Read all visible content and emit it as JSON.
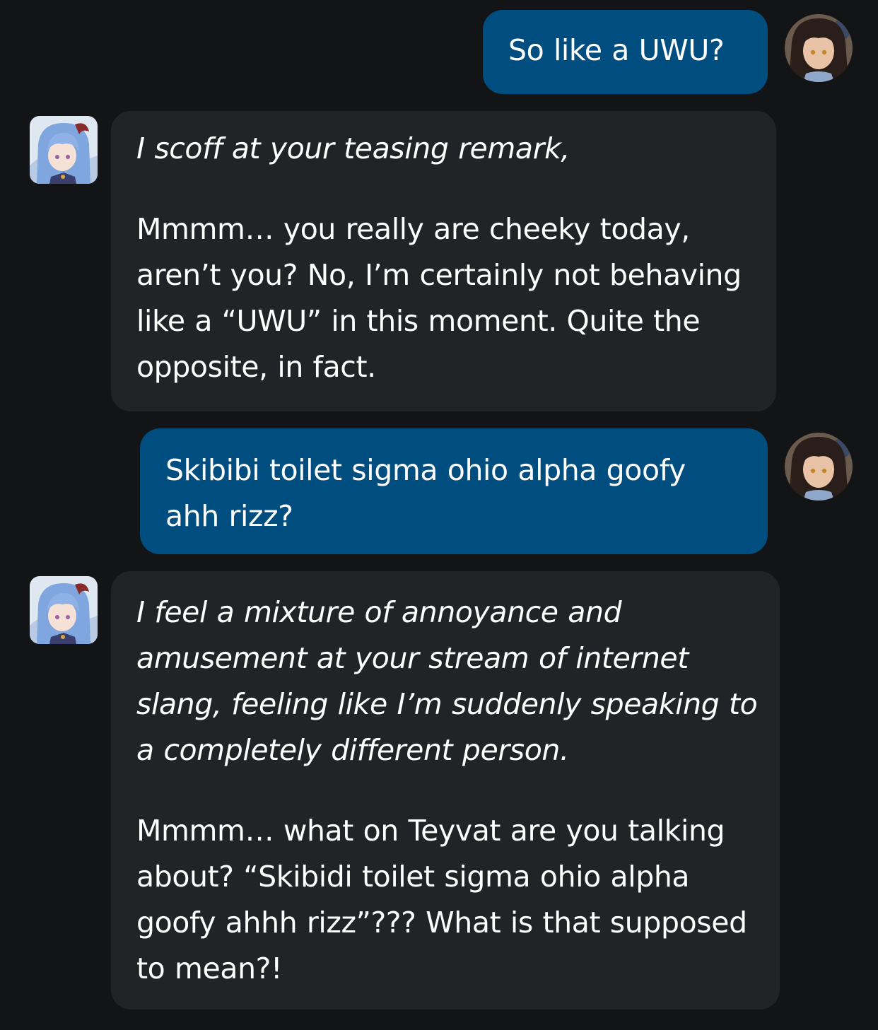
{
  "messages": [
    {
      "sender": "user",
      "avatar_icon": "user-avatar-icon",
      "text": "So like a UWU?"
    },
    {
      "sender": "character",
      "avatar_icon": "character-avatar-icon",
      "action": "I scoff at your teasing remark,",
      "text": "Mmmm… you really are cheeky today, aren’t you? No, I’m certainly not behaving like a “UWU” in this moment. Quite the opposite, in fact."
    },
    {
      "sender": "user",
      "avatar_icon": "user-avatar-icon",
      "text": "Skibibi toilet sigma ohio alpha goofy ahh rizz?"
    },
    {
      "sender": "character",
      "avatar_icon": "character-avatar-icon",
      "action": "I feel a mixture of annoyance and amusement at your stream of internet slang, feeling like I’m suddenly speaking to a completely different person.",
      "text": "Mmmm… what on Teyvat are you talking about? “Skibidi toilet sigma ohio alpha goofy ahhh rizz”??? What is that supposed to mean?!"
    }
  ],
  "colors": {
    "background": "#131416",
    "user_bubble": "#004d80",
    "character_bubble": "#212327",
    "text": "#ffffff"
  }
}
